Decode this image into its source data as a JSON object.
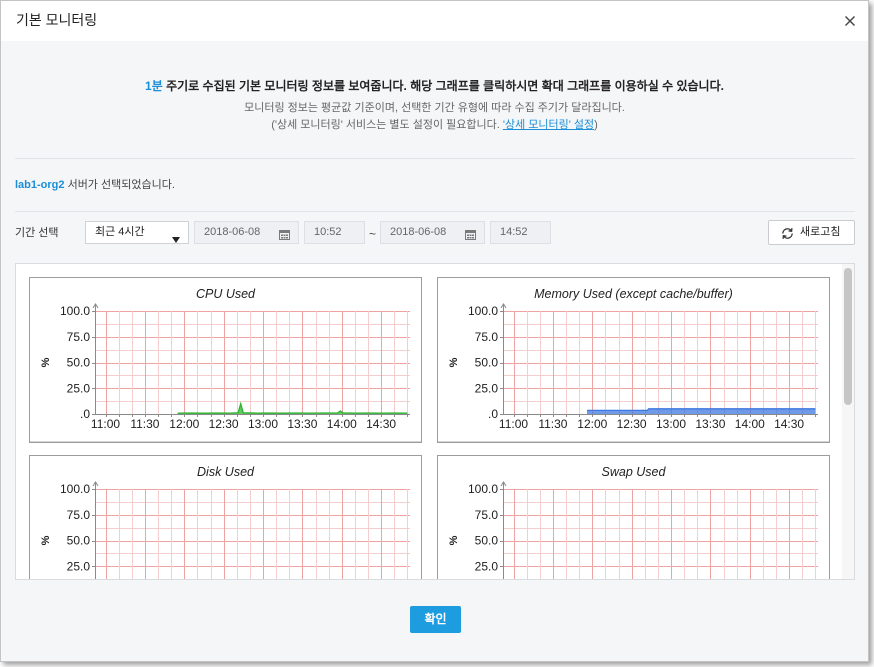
{
  "dialog": {
    "title": "기본 모니터링"
  },
  "intro": {
    "highlight": "1분",
    "main_text": " 주기로 수집된 기본 모니터링 정보를 보여줍니다. 해당 그래프를 클릭하시면 확대 그래프를 이용하실 수 있습니다.",
    "note_line1": "모니터링 정보는 평균값 기준이며, 선택한 기간 유형에 따라 수집 주기가 달라집니다.",
    "note_line2_prefix": "('상세 모니터링' 서비스는 별도 설정이 필요합니다. ",
    "note_link": "'상세 모니터링' 설정",
    "note_line2_suffix": ")"
  },
  "server": {
    "name": "lab1-org2",
    "selected_text": " 서버가 선택되었습니다."
  },
  "period": {
    "label": "기간 선택",
    "preset": "최근 4시간",
    "start_date": "2018-06-08",
    "start_time": "10:52",
    "separator": "~",
    "end_date": "2018-06-08",
    "end_time": "14:52",
    "refresh_label": "새로고침"
  },
  "footer": {
    "confirm_label": "확인"
  },
  "icons": {
    "close": "close-icon",
    "dropdown": "chevron-down-icon",
    "calendar": "calendar-icon",
    "refresh": "refresh-icon"
  },
  "colors": {
    "accent": "#1a8fd8",
    "confirm_button": "#1d9ce0",
    "grid": "#f2b4b4"
  },
  "chart_data": [
    {
      "type": "area",
      "title": "CPU Used",
      "ylabel": "%",
      "ylim": [
        0,
        100
      ],
      "yticks": [
        "100.0",
        "75.0",
        "50.0",
        "25.0",
        ".0"
      ],
      "xlim": [
        "10:52",
        "14:52"
      ],
      "xticks": [
        "11:00",
        "11:30",
        "12:00",
        "12:30",
        "13:00",
        "13:30",
        "14:00",
        "14:30"
      ],
      "grid": true,
      "series": [
        {
          "color": "#2fb42f",
          "x": [
            "11:55",
            "12:05",
            "12:15",
            "12:25",
            "12:35",
            "12:41",
            "12:43",
            "12:45",
            "12:55",
            "13:05",
            "13:15",
            "13:25",
            "13:35",
            "13:45",
            "13:57",
            "13:59",
            "14:01",
            "14:10",
            "14:20",
            "14:30",
            "14:40",
            "14:50"
          ],
          "y": [
            0.8,
            1.0,
            0.8,
            1.0,
            0.9,
            1.2,
            10.0,
            1.2,
            0.9,
            1.0,
            0.8,
            1.0,
            0.9,
            1.0,
            1.1,
            3.0,
            1.1,
            0.9,
            1.0,
            0.9,
            1.0,
            0.9
          ]
        }
      ]
    },
    {
      "type": "area",
      "title": "Memory Used (except cache/buffer)",
      "ylabel": "%",
      "ylim": [
        0,
        100
      ],
      "yticks": [
        "100.0",
        "75.0",
        "50.0",
        "25.0",
        ".0"
      ],
      "xlim": [
        "10:52",
        "14:52"
      ],
      "xticks": [
        "11:00",
        "11:30",
        "12:00",
        "12:30",
        "13:00",
        "13:30",
        "14:00",
        "14:30"
      ],
      "grid": true,
      "series": [
        {
          "color": "#3f78e0",
          "x": [
            "11:56",
            "12:42",
            "12:43",
            "14:50"
          ],
          "y": [
            3.5,
            3.5,
            5.0,
            5.0
          ]
        }
      ]
    },
    {
      "type": "area",
      "title": "Disk Used",
      "ylabel": "%",
      "ylim": [
        0,
        100
      ],
      "yticks": [
        "100.0",
        "75.0",
        "50.0",
        "25.0"
      ],
      "xlim": [
        "10:52",
        "14:52"
      ],
      "xticks": [],
      "grid": true,
      "series": []
    },
    {
      "type": "area",
      "title": "Swap Used",
      "ylabel": "%",
      "ylim": [
        0,
        100
      ],
      "yticks": [
        "100.0",
        "75.0",
        "50.0",
        "25.0"
      ],
      "xlim": [
        "10:52",
        "14:52"
      ],
      "xticks": [],
      "grid": true,
      "series": []
    }
  ]
}
